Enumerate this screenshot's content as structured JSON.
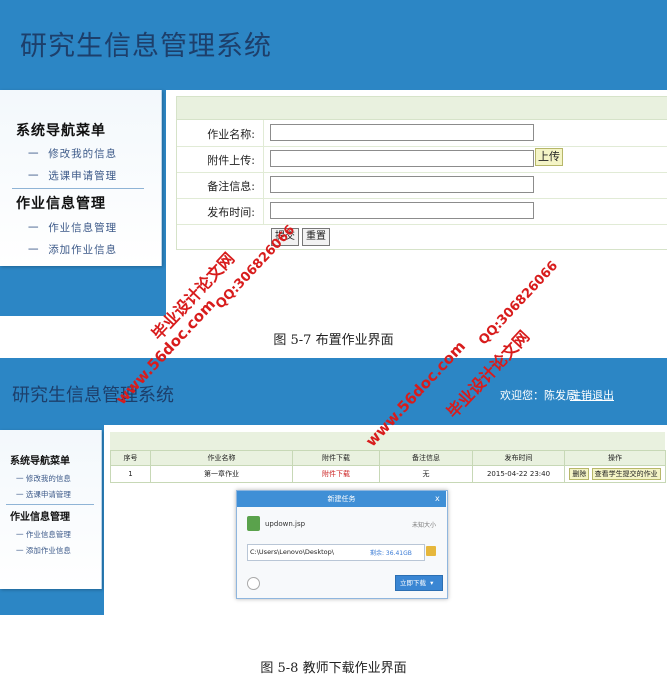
{
  "figure1": {
    "app_title": "研究生信息管理系统",
    "nav": {
      "section1_title": "系统导航菜单",
      "section1_items": [
        "修改我的信息",
        "选课申请管理"
      ],
      "section2_title": "作业信息管理",
      "section2_items": [
        "作业信息管理",
        "添加作业信息"
      ]
    },
    "form": {
      "name_label": "作业名称:",
      "attachment_label": "附件上传:",
      "upload_button": "上传",
      "note_label": "备注信息:",
      "publish_time_label": "发布时间:",
      "submit_button": "提交",
      "reset_button": "重置"
    },
    "caption": "图 5-7 布置作业界面"
  },
  "figure2": {
    "app_title": "研究生信息管理系统",
    "welcome_text": "欢迎您：陈发局",
    "logout_link": "注销退出",
    "nav": {
      "section1_title": "系统导航菜单",
      "section1_items": [
        "修改我的信息",
        "选课申请管理"
      ],
      "section2_title": "作业信息管理",
      "section2_items": [
        "作业信息管理",
        "添加作业信息"
      ]
    },
    "table": {
      "headers": [
        "序号",
        "作业名称",
        "附件下载",
        "备注信息",
        "发布时间",
        "操作"
      ],
      "rows": [
        {
          "index": "1",
          "name": "第一章作业",
          "attachment": "附件下载",
          "note": "无",
          "time": "2015-04-22 23:40",
          "delete_btn": "删除",
          "view_btn": "查看学生提交的作业"
        }
      ]
    },
    "download_dialog": {
      "title": "新建任务",
      "close": "x",
      "file_name": "updown.jsp",
      "file_size": "未知大小",
      "path": "C:\\Users\\Lenovo\\Desktop\\",
      "free_space": "剩余: 36.41GB",
      "download_button": "立即下载"
    },
    "caption": "图 5-8 教师下载作业界面"
  },
  "watermarks": {
    "site": "www.56doc.com",
    "brand": "毕业设计论文网",
    "qq": "QQ:306826066"
  }
}
